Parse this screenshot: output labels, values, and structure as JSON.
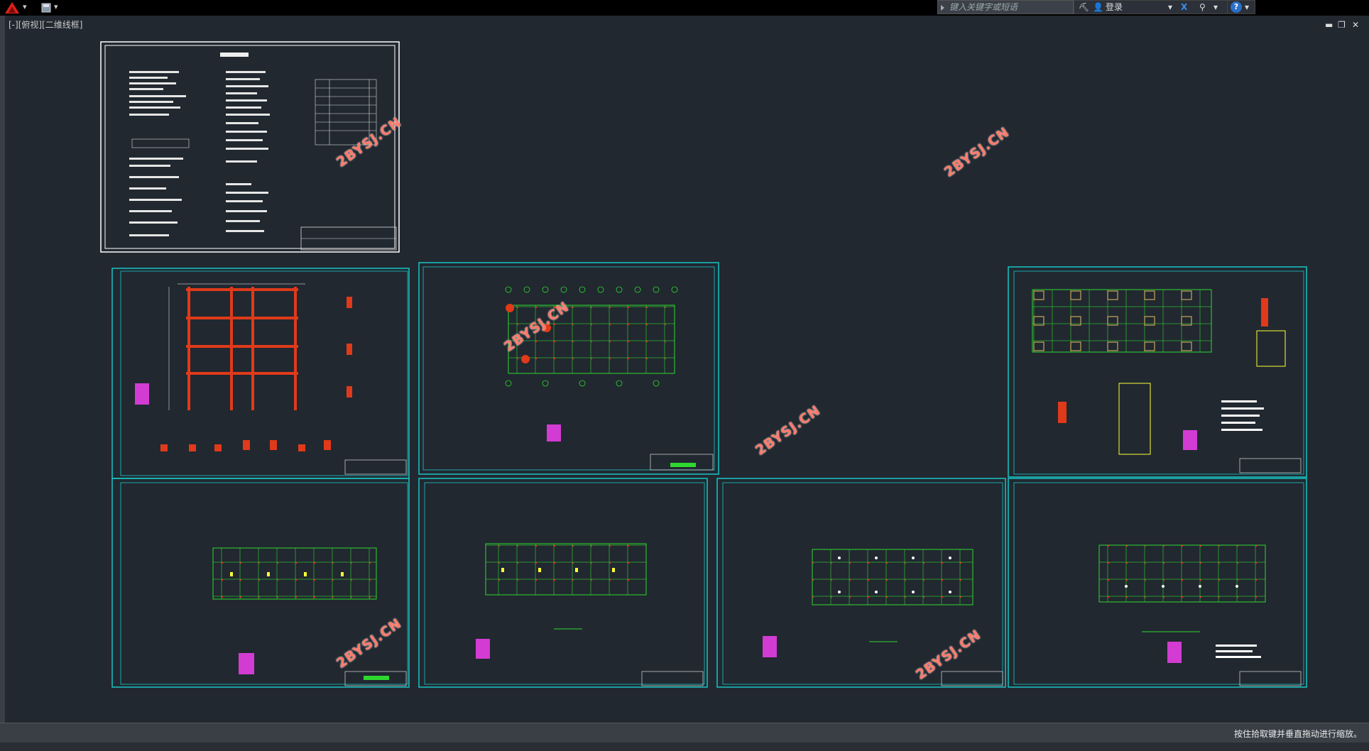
{
  "toolbar": {
    "search_placeholder": "键入关键字或短语",
    "login_label": "登录",
    "help_label": "?"
  },
  "viewport": {
    "label": "[-][俯视][二维线框]"
  },
  "status": {
    "message": "按住拾取键并垂直拖动进行缩放。"
  },
  "watermarks": {
    "text": "2BYSJ.CN"
  },
  "colors": {
    "canvas": "#212830",
    "sheet_frame": "#19c6c6",
    "gridline": "#2fd82f",
    "axis_bubble": "#2fd82f",
    "column": "#e03a1a",
    "beam": "#e03a1a",
    "dim_text": "#ffffff",
    "annotation": "#ffff33",
    "magenta": "#d23cd2",
    "watermark": "#ff7a6a"
  },
  "sheets": [
    {
      "id": "design-notes",
      "type": "notes"
    },
    {
      "id": "frame-elevation",
      "type": "elevation"
    },
    {
      "id": "column-plan",
      "type": "plan"
    },
    {
      "id": "foundation-plan",
      "type": "foundation"
    },
    {
      "id": "floor-plan-1",
      "type": "plan"
    },
    {
      "id": "floor-plan-2",
      "type": "plan"
    },
    {
      "id": "slab-plan",
      "type": "slab"
    },
    {
      "id": "roof-plan",
      "type": "roof"
    }
  ]
}
